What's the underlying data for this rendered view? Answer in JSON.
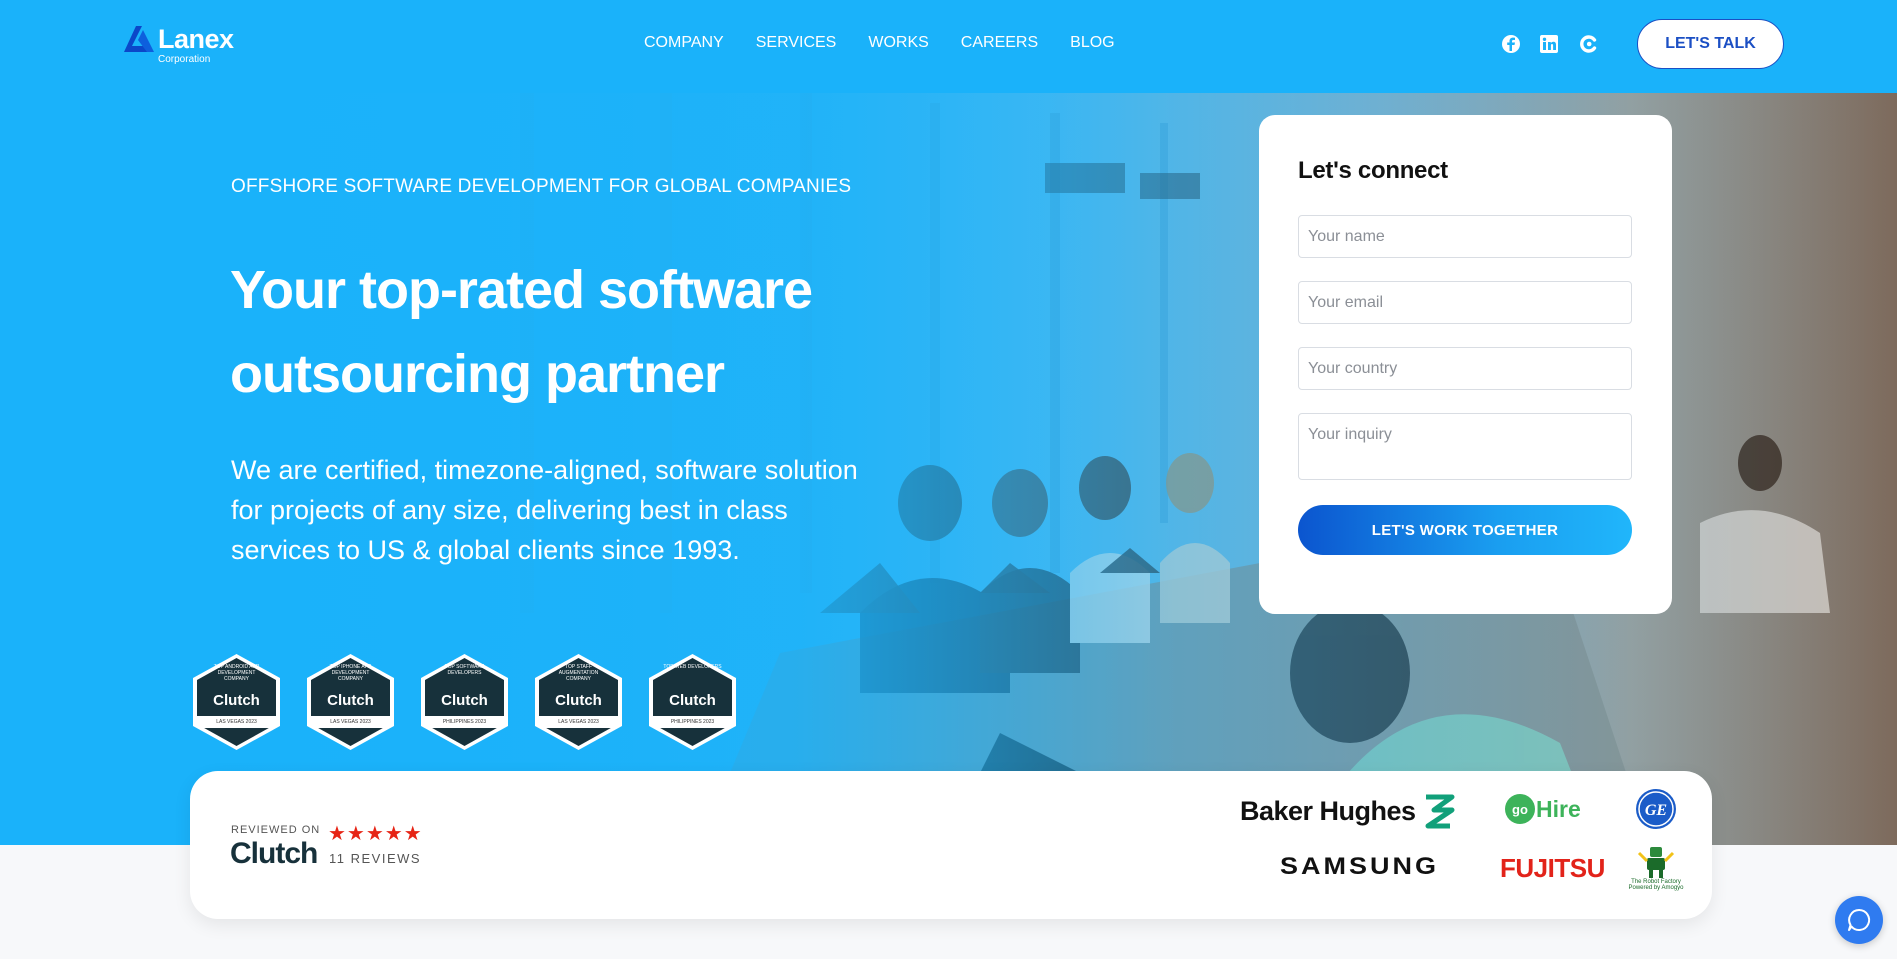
{
  "header": {
    "logo_word": "Lanex",
    "logo_sub": "Corporation",
    "nav": [
      "COMPANY",
      "SERVICES",
      "WORKS",
      "CAREERS",
      "BLOG"
    ],
    "social_icons": [
      "facebook-icon",
      "linkedin-icon",
      "clutch-icon"
    ],
    "cta": "LET'S TALK"
  },
  "hero": {
    "kicker": "OFFSHORE SOFTWARE DEVELOPMENT FOR GLOBAL COMPANIES",
    "title": "Your top-rated software outsourcing partner",
    "description": "We are certified, timezone-aligned, software solution for projects of any size, delivering best in class services to US & global clients since 1993.",
    "badges": [
      {
        "top": "TOP ANDROID APP DEVELOPMENT COMPANY",
        "brand": "Clutch",
        "loc": "LAS VEGAS 2023"
      },
      {
        "top": "TOP IPHONE APP DEVELOPMENT COMPANY",
        "brand": "Clutch",
        "loc": "LAS VEGAS 2023"
      },
      {
        "top": "TOP SOFTWARE DEVELOPERS",
        "brand": "Clutch",
        "loc": "PHILIPPINES 2023"
      },
      {
        "top": "TOP STAFF AUGMENTATION COMPANY",
        "brand": "Clutch",
        "loc": "LAS VEGAS 2023"
      },
      {
        "top": "TOP WEB DEVELOPERS",
        "brand": "Clutch",
        "loc": "PHILIPPINES 2023"
      }
    ]
  },
  "form": {
    "title": "Let's connect",
    "name_placeholder": "Your name",
    "email_placeholder": "Your email",
    "country_placeholder": "Your country",
    "inquiry_placeholder": "Your inquiry",
    "submit": "LET'S WORK TOGETHER"
  },
  "clients": {
    "reviewed_on": "REVIEWED ON",
    "clutch": "Clutch",
    "stars": "★★★★★",
    "reviews": "11 REVIEWS",
    "logos": {
      "baker": "Baker Hughes",
      "gohire": "goHire",
      "ge": "GE",
      "samsung": "SAMSUNG",
      "fujitsu": "FUJITSU",
      "robot": "The Robot Factory Powered by Amogyo"
    }
  },
  "colors": {
    "header_bg": "#1ab2fa",
    "accent": "#1b4fc4",
    "star": "#e62415"
  }
}
